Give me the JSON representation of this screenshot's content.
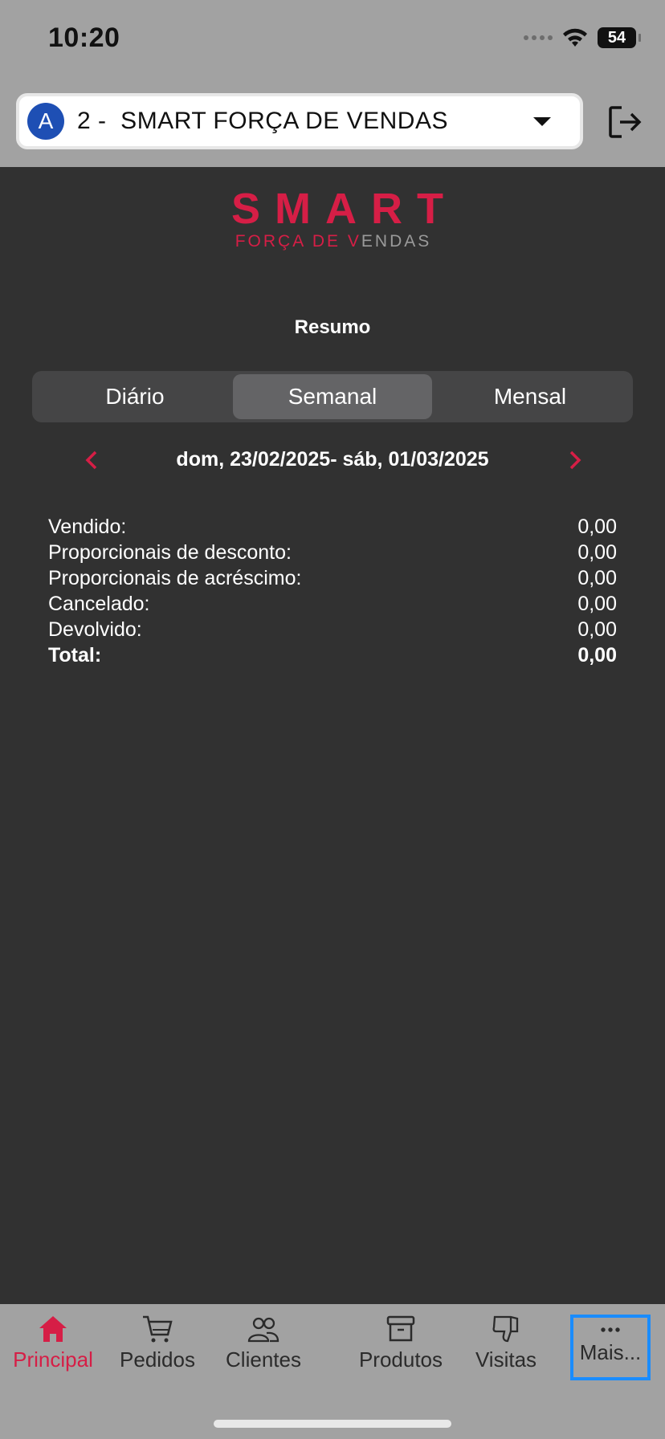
{
  "status_bar": {
    "time": "10:20",
    "battery": "54"
  },
  "header": {
    "company_avatar_letter": "A",
    "company_label": "2 -  SMART FORÇA DE VENDAS",
    "icons": {
      "dropdown": "chevron-down-icon",
      "logout": "logout-icon"
    }
  },
  "logo": {
    "main": "SMART",
    "sub_red": "FORÇA DE V",
    "sub_gray": "ENDAS"
  },
  "resumo": {
    "title": "Resumo",
    "tabs": [
      {
        "label": "Diário",
        "active": false
      },
      {
        "label": "Semanal",
        "active": true
      },
      {
        "label": "Mensal",
        "active": false
      }
    ],
    "date_range": "dom, 23/02/2025- sáb, 01/03/2025",
    "rows": [
      {
        "label": "Vendido:",
        "value": "0,00"
      },
      {
        "label": "Proporcionais de desconto:",
        "value": "0,00"
      },
      {
        "label": "Proporcionais de acréscimo:",
        "value": "0,00"
      },
      {
        "label": "Cancelado:",
        "value": "0,00"
      },
      {
        "label": "Devolvido:",
        "value": "0,00"
      },
      {
        "label": "Total:",
        "value": "0,00"
      }
    ]
  },
  "bottom_nav": {
    "items": [
      {
        "label": "Principal",
        "icon": "home-icon",
        "active": true
      },
      {
        "label": "Pedidos",
        "icon": "cart-icon",
        "active": false
      },
      {
        "label": "Clientes",
        "icon": "users-icon",
        "active": false
      },
      {
        "label": "Produtos",
        "icon": "archive-icon",
        "active": false
      },
      {
        "label": "Visitas",
        "icon": "thumbs-down-icon",
        "active": false
      },
      {
        "label": "Mais...",
        "icon": "more-icon",
        "active": false
      }
    ]
  },
  "colors": {
    "accent": "#d61e46",
    "background": "#313131",
    "bar_gray": "#a2a2a2",
    "selection_outline": "#1a8cff",
    "avatar_blue": "#1e4fb4"
  }
}
